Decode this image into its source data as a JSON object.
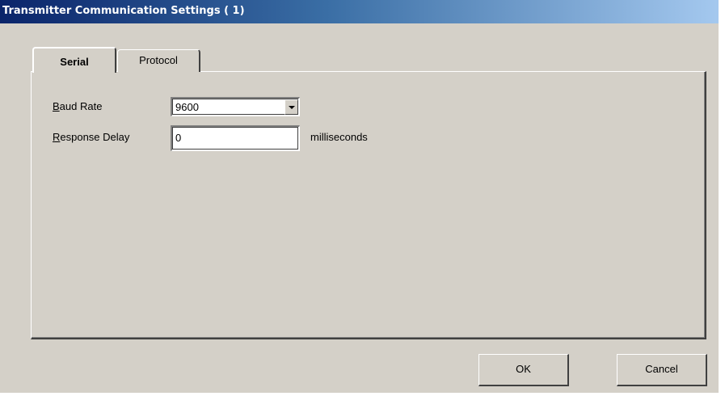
{
  "window": {
    "title": "Transmitter Communication Settings ( 1)"
  },
  "tabs": [
    {
      "label": "Serial",
      "selected": true
    },
    {
      "label": "Protocol",
      "selected": false
    }
  ],
  "serial": {
    "baud_rate": {
      "label_accel": "B",
      "label_rest": "aud Rate",
      "value": "9600"
    },
    "response_delay": {
      "label_accel": "R",
      "label_rest": "esponse Delay",
      "value": "0",
      "unit": "milliseconds"
    }
  },
  "buttons": {
    "ok": "OK",
    "cancel": "Cancel"
  },
  "icons": {
    "combo_arrow": "chevron-down-icon"
  },
  "colors": {
    "dialog_bg": "#d4d0c8",
    "title_gradient_start": "#0a246a",
    "title_gradient_end": "#a6caf0"
  }
}
